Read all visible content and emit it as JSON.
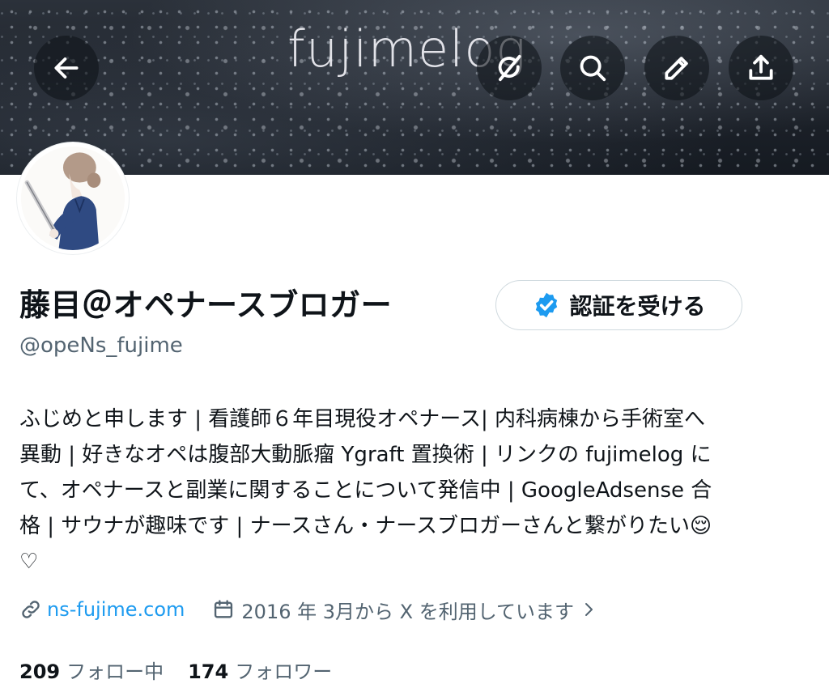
{
  "banner": {
    "title": "fujimelog"
  },
  "header_icons": [
    "back-arrow-icon",
    "grok-icon",
    "search-icon",
    "pencil-icon",
    "share-icon"
  ],
  "profile": {
    "display_name": "藤目＠オペナースブロガー",
    "verify_button_label": "認証を受ける",
    "handle": "@opeNs_fujime",
    "bio_lines": [
      "ふじめと申します | 看護師６年目現役オペナース| 内科病棟から手術室へ",
      "異動 | 好きなオペは腹部大動脈瘤 Ygraft 置換術 | リンクの fujimelog に",
      "て、オペナースと副業に関することについて発信中 | GoogleAdsense 合",
      "格 | サウナが趣味です | ナースさん・ナースブロガーさんと繋がりたい😌",
      "♡"
    ],
    "website": "ns-fujime.com",
    "joined": "2016 年 3月から X を利用しています"
  },
  "stats": {
    "following_count": "209",
    "following_label": "フォロー中",
    "followers_count": "174",
    "followers_label": "フォロワー"
  },
  "colors": {
    "accent": "#1d9bf0",
    "text_primary": "#0f1419",
    "text_secondary": "#536471",
    "border": "#cfd9de"
  }
}
